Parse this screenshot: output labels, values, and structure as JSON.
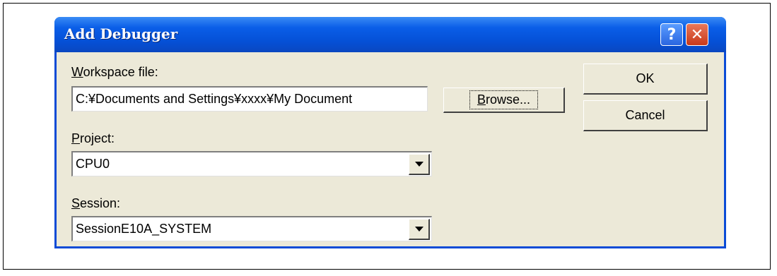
{
  "dialog": {
    "title": "Add Debugger",
    "help_glyph": "?",
    "close_glyph": "✕"
  },
  "workspace": {
    "label_accel": "W",
    "label_rest": "orkspace file:",
    "value": "C:¥Documents and Settings¥xxxx¥My Document"
  },
  "browse": {
    "label_accel": "B",
    "label_rest": "rowse..."
  },
  "project": {
    "label_accel": "P",
    "label_rest": "roject:",
    "value": "CPU0"
  },
  "session": {
    "label_accel": "S",
    "label_rest": "ession:",
    "value": "SessionE10A_SYSTEM"
  },
  "buttons": {
    "ok": "OK",
    "cancel": "Cancel"
  }
}
